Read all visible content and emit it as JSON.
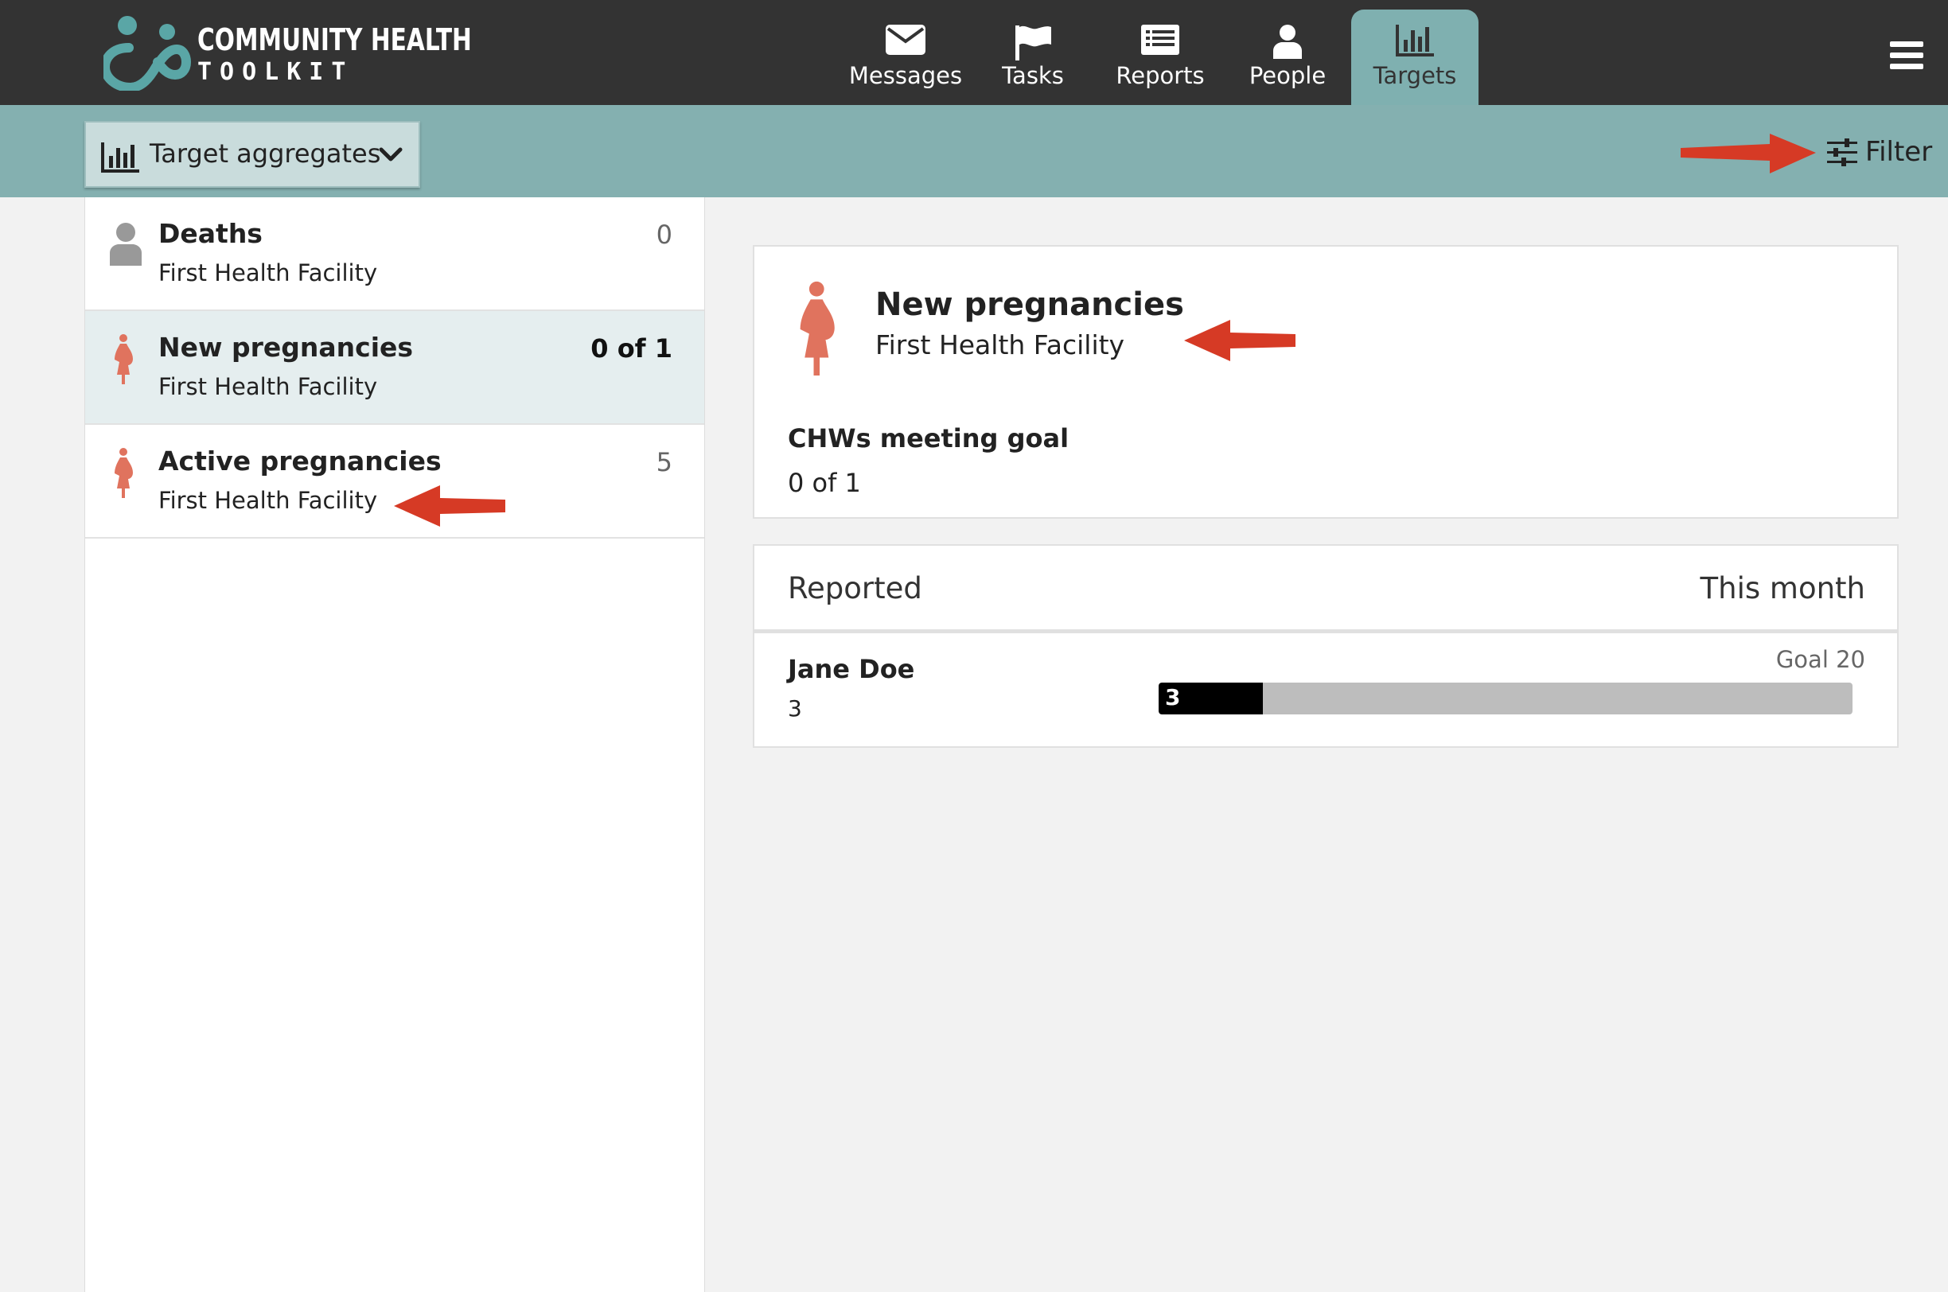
{
  "logo": {
    "line1": "COMMUNITY HEALTH",
    "line2": "TOOLKIT"
  },
  "nav": {
    "messages": "Messages",
    "tasks": "Tasks",
    "reports": "Reports",
    "people": "People",
    "targets": "Targets"
  },
  "toolbar": {
    "aggregates_label": "Target aggregates",
    "filter_label": "Filter"
  },
  "list": {
    "items": [
      {
        "title": "Deaths",
        "subtitle": "First Health Facility",
        "value": "0"
      },
      {
        "title": "New pregnancies",
        "subtitle": "First Health Facility",
        "value": "0 of 1"
      },
      {
        "title": "Active pregnancies",
        "subtitle": "First Health Facility",
        "value": "5"
      }
    ]
  },
  "detail": {
    "title": "New pregnancies",
    "subtitle": "First Health Facility",
    "goal_label": "CHWs meeting goal",
    "goal_value": "0 of 1",
    "table_header_left": "Reported",
    "table_header_right": "This month",
    "rows": [
      {
        "name": "Jane Doe",
        "count": "3",
        "goal": "Goal 20",
        "bar_label": "3",
        "progress": 0.15
      }
    ]
  },
  "colors": {
    "topbar": "#333333",
    "subbar": "#84b0b0",
    "active_tab": "#7fb0b0",
    "pregnancy_icon": "#e0735e",
    "person_icon": "#999999",
    "annotation_arrow": "#d63a25",
    "logo_teal": "#5aa6a6"
  }
}
